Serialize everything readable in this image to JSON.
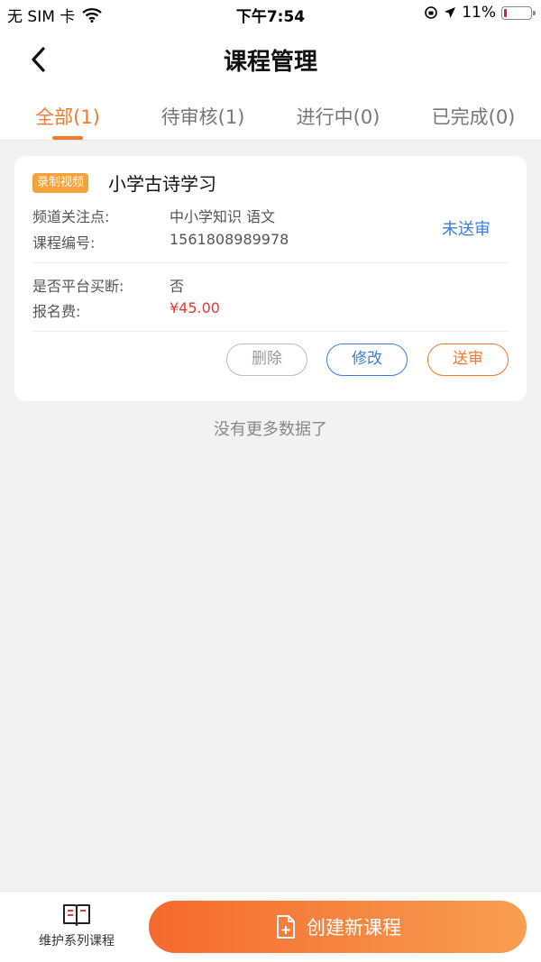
{
  "status_bar": {
    "carrier": "无 SIM 卡",
    "time": "下午7:54",
    "battery": "11%",
    "battery_level": 0.11
  },
  "header": {
    "title": "课程管理"
  },
  "tabs": [
    {
      "label": "全部(1)",
      "active": true
    },
    {
      "label": "待审核(1)",
      "active": false
    },
    {
      "label": "进行中(0)",
      "active": false
    },
    {
      "label": "已完成(0)",
      "active": false
    }
  ],
  "course": {
    "tag": "录制视频",
    "name": "小学古诗学习",
    "focus_label": "频道关注点:",
    "focus_value": "中小学知识 语文",
    "code_label": "课程编号:",
    "code_value": "1561808989978",
    "review_status": "未送审",
    "buyout_label": "是否平台买断:",
    "buyout_value": "否",
    "fee_label": "报名费:",
    "fee_value": "¥45.00",
    "actions": {
      "delete": "删除",
      "edit": "修改",
      "submit": "送审"
    }
  },
  "no_more": "没有更多数据了",
  "bottom_bar": {
    "series_label": "维护系列课程",
    "series_icon": "book-icon",
    "create_label": "创建新课程",
    "create_icon": "new-file-icon"
  },
  "colors": {
    "accent": "#f5782e",
    "link": "#3b7fd8",
    "price": "#e53935",
    "tag": "#f5a13c"
  }
}
